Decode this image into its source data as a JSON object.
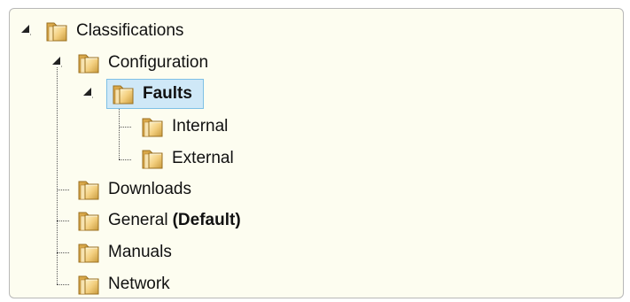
{
  "tree": {
    "root": {
      "label": "Classifications",
      "icon": "folder-icon"
    },
    "configuration": {
      "label": "Configuration",
      "icon": "folder-icon"
    },
    "faults": {
      "label": "Faults",
      "icon": "folder-icon",
      "selected": true
    },
    "internal": {
      "label": "Internal",
      "icon": "folder-icon"
    },
    "external": {
      "label": "External",
      "icon": "folder-icon"
    },
    "downloads": {
      "label": "Downloads",
      "icon": "folder-icon"
    },
    "general": {
      "label": "General",
      "badge": "(Default)",
      "icon": "folder-icon"
    },
    "manuals": {
      "label": "Manuals",
      "icon": "folder-icon"
    },
    "network": {
      "label": "Network",
      "icon": "folder-icon"
    }
  },
  "colors": {
    "panel_background": "#fdfdf0",
    "selection_background": "#cfe8f7",
    "selection_border": "#7ec0e6",
    "folder": "#e8b860"
  }
}
